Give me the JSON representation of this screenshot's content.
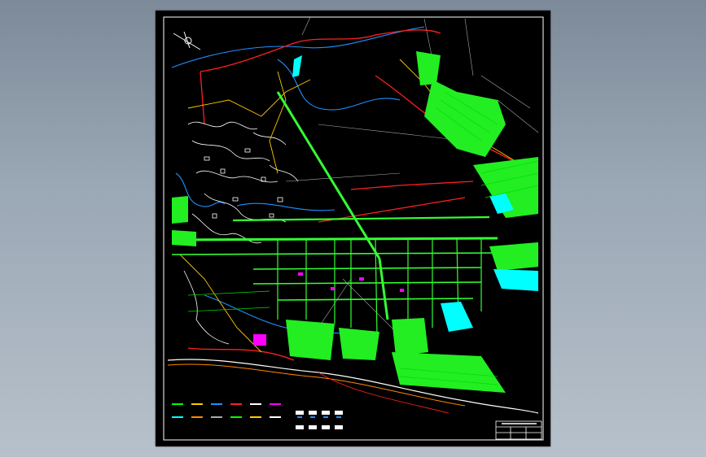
{
  "viewer": {
    "background_color": "#8f9cab"
  },
  "drawing": {
    "background_color": "#000000",
    "frame_color": "#ffffff",
    "title_block_label": "",
    "layer_colors": {
      "road": "#00ff00",
      "main_road": "#33ff33",
      "boundary": "#ff2020",
      "river": "#1e90ff",
      "contour": "#ffffff",
      "utility": "#ffcc00",
      "water_body": "#00ffff",
      "special": "#ff00ff",
      "railway": "#ff8800"
    },
    "north_arrow_icon": "north-arrow-icon"
  }
}
